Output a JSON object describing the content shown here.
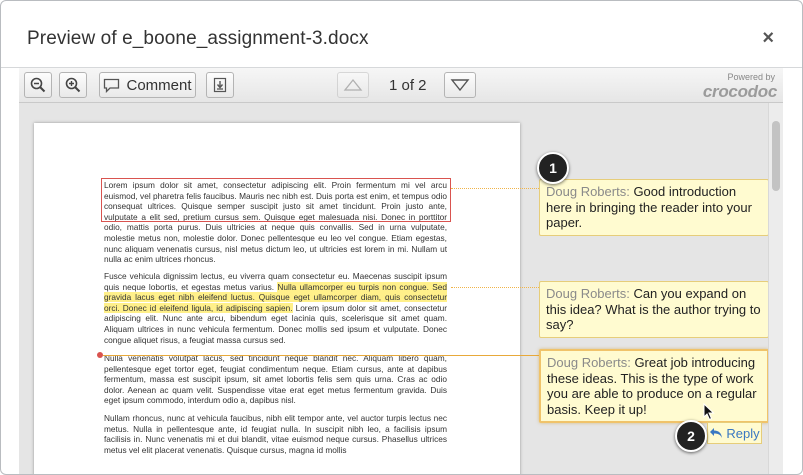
{
  "dialog": {
    "title": "Preview of e_boone_assignment-3.docx",
    "close_label": "×"
  },
  "toolbar": {
    "zoom_out_icon": "zoom-out-icon",
    "zoom_in_icon": "zoom-in-icon",
    "comment_label": "Comment",
    "download_icon": "download-icon",
    "page_indicator": "1 of 2",
    "prev_icon": "triangle-up-icon",
    "next_icon": "triangle-down-icon",
    "brand_powered": "Powered by",
    "brand_name": "crocodoc"
  },
  "document": {
    "para1_boxed": "Lorem ipsum dolor sit amet, consectetur adipiscing elit. Proin fermentum mi vel arcu euismod, vel pharetra felis faucibus. Mauris nec nibh est. Duis porta est enim, et tempus odio consequat ultrices. Quisque semper suscipit justo sit amet tincidunt. Proin justo ante, vulputate a elit sed, pretium cursus sem. Quisque eget malesuada nisi. Donec in",
    "para1_rest": "porttitor odio, mattis porta purus. Duis ultricies at neque quis convallis. Sed in urna vulputate, molestie metus non, molestie dolor. Donec pellentesque eu leo vel congue. Etiam egestas, nunc aliquam venenatis cursus, nisl metus dictum leo, ut ultricies est lorem in mi. Nullam ut nulla ac enim ultrices rhoncus.",
    "para2_a": "Fusce vehicula dignissim lectus, eu viverra quam consectetur eu. Maecenas suscipit ipsum quis neque lobortis, et egestas metus varius. ",
    "para2_hl": "Nulla ullamcorper eu turpis non congue. Sed gravida lacus eget nibh eleifend luctus. Quisque eget ullamcorper diam, quis consectetur orci. Donec id eleifend ligula, id adipiscing sapien.",
    "para2_b": " Lorem ipsum dolor sit amet, consectetur adipiscing elit. Nunc ante arcu, bibendum eget lacinia quis, scelerisque sit amet quam. Aliquam ultrices in nunc vehicula fermentum. Donec mollis sed ipsum et vulputate. Donec congue aliquet risus, a feugiat massa cursus sed.",
    "para3": "Nulla venenatis volutpat lacus, sed tincidunt neque blandit nec. Aliquam libero quam, pellentesque eget tortor eget, feugiat condimentum neque. Etiam cursus, ante at dapibus fermentum, massa est suscipit ipsum, sit amet lobortis felis sem quis urna. Cras ac odio dolor. Aenean ac quam velit. Suspendisse vitae erat eget metus fermentum gravida. Duis eget ipsum commodo, interdum odio a, dapibus nisl.",
    "para4": "Nullam rhoncus, nunc at vehicula faucibus, nibh elit tempor ante, vel auctor turpis lectus nec metus. Nulla in pellentesque ante, id feugiat nulla. In suscipit nibh leo, a facilisis ipsum facilisis in. Nunc venenatis mi et dui blandit, vitae euismod neque cursus. Phasellus ultrices metus vel elit placerat venenatis. Quisque cursus, magna id mollis"
  },
  "comments": [
    {
      "author": "Doug Roberts:",
      "text": " Good introduction here in bringing the reader into your paper."
    },
    {
      "author": "Doug Roberts:",
      "text": " Can you expand on this idea? What is the author trying to say?"
    },
    {
      "author": "Doug Roberts:",
      "text": " Great job introducing these ideas. This is the type of work you are able to produce on a regular basis. Keep it up!"
    }
  ],
  "reply_label": "Reply",
  "steps": [
    "1",
    "2"
  ],
  "colors": {
    "highlight": "#fff08a",
    "comment_bg": "#fffbd0",
    "connector": "#f0b44a",
    "box": "#d9534f",
    "link": "#3a78c2"
  }
}
